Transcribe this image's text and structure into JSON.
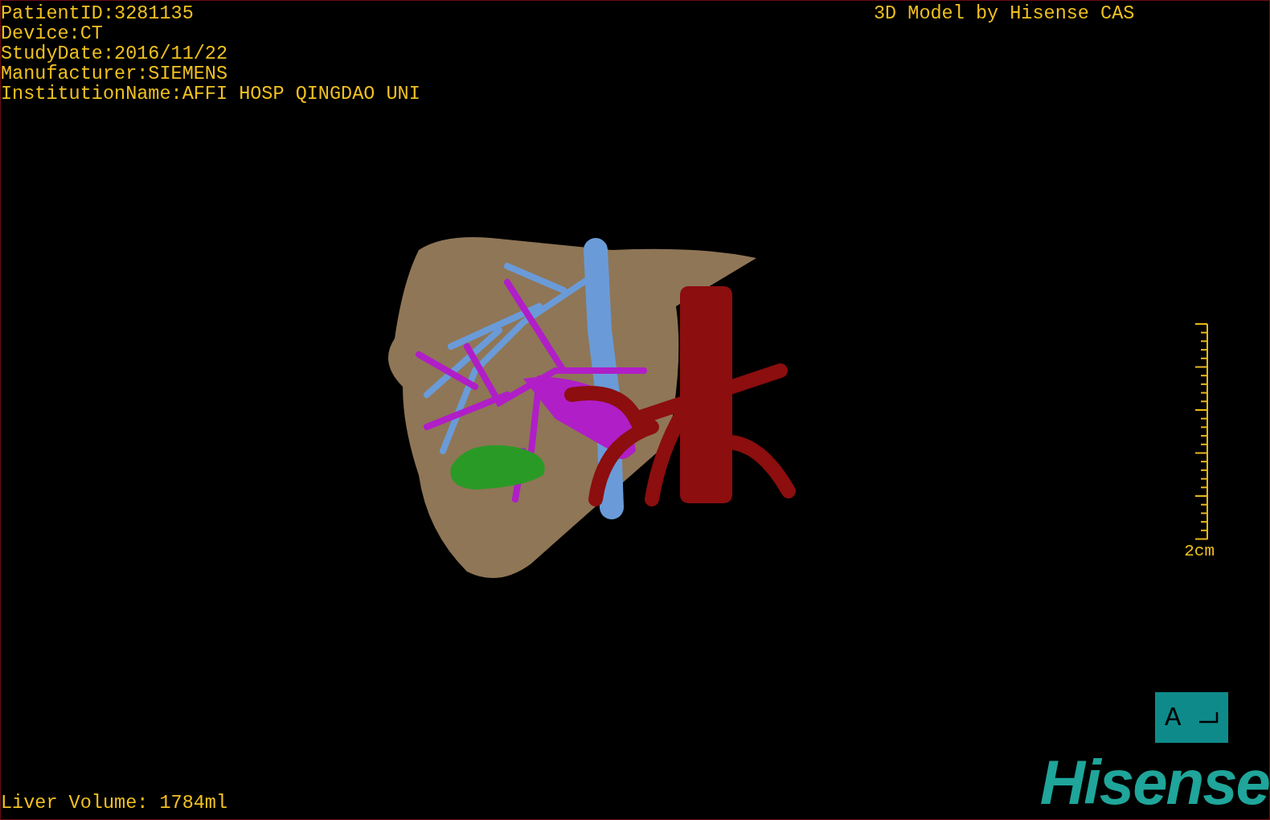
{
  "viewer": {
    "info_lines": [
      "PatientID:3281135",
      "Device:CT",
      "StudyDate:2016/11/22",
      "Manufacturer:SIEMENS",
      "InstitutionName:AFFI HOSP QINGDAO UNI"
    ],
    "title": "3D Model by Hisense CAS",
    "scale_label": "2cm",
    "orientation_label": "A",
    "measurement": "Liver Volume: 1784ml",
    "logo": "Hisense"
  }
}
